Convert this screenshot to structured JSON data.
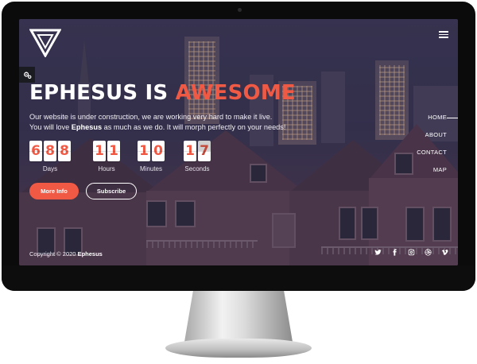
{
  "brand": {
    "name": "Ephesus",
    "accent_color": "#f05a45"
  },
  "hero": {
    "title_prefix": "EPHESUS IS",
    "title_accent": "AWESOME",
    "text_line1": "Our website is under construction, we are working very hard to make it live.",
    "text_line2_before": "You will love",
    "text_line2_bold": "Ephesus",
    "text_line2_after": "as much as we do. It will morph perfectly on your needs!"
  },
  "countdown": {
    "days": {
      "digits": [
        "6",
        "8",
        "8"
      ],
      "label": "Days"
    },
    "hours": {
      "digits": [
        "1",
        "1"
      ],
      "label": "Hours"
    },
    "minutes": {
      "digits": [
        "1",
        "0"
      ],
      "label": "Minutes"
    },
    "seconds": {
      "digits": [
        "1",
        "7"
      ],
      "label": "Seconds"
    }
  },
  "buttons": {
    "more_info": "More Info",
    "subscribe": "Subscribe"
  },
  "nav": {
    "items": [
      {
        "label": "HOME",
        "active": true
      },
      {
        "label": "ABOUT",
        "active": false
      },
      {
        "label": "CONTACT",
        "active": false
      },
      {
        "label": "MAP",
        "active": false
      }
    ]
  },
  "footer": {
    "copyright_prefix": "Copyright © 2020",
    "copyright_brand": "Ephesus"
  },
  "icons": {
    "logo": "triangle-logo-icon",
    "menu": "hamburger-menu-icon",
    "settings": "gears-icon",
    "social": [
      "twitter-icon",
      "facebook-icon",
      "instagram-icon",
      "dribbble-icon",
      "vimeo-icon"
    ]
  }
}
